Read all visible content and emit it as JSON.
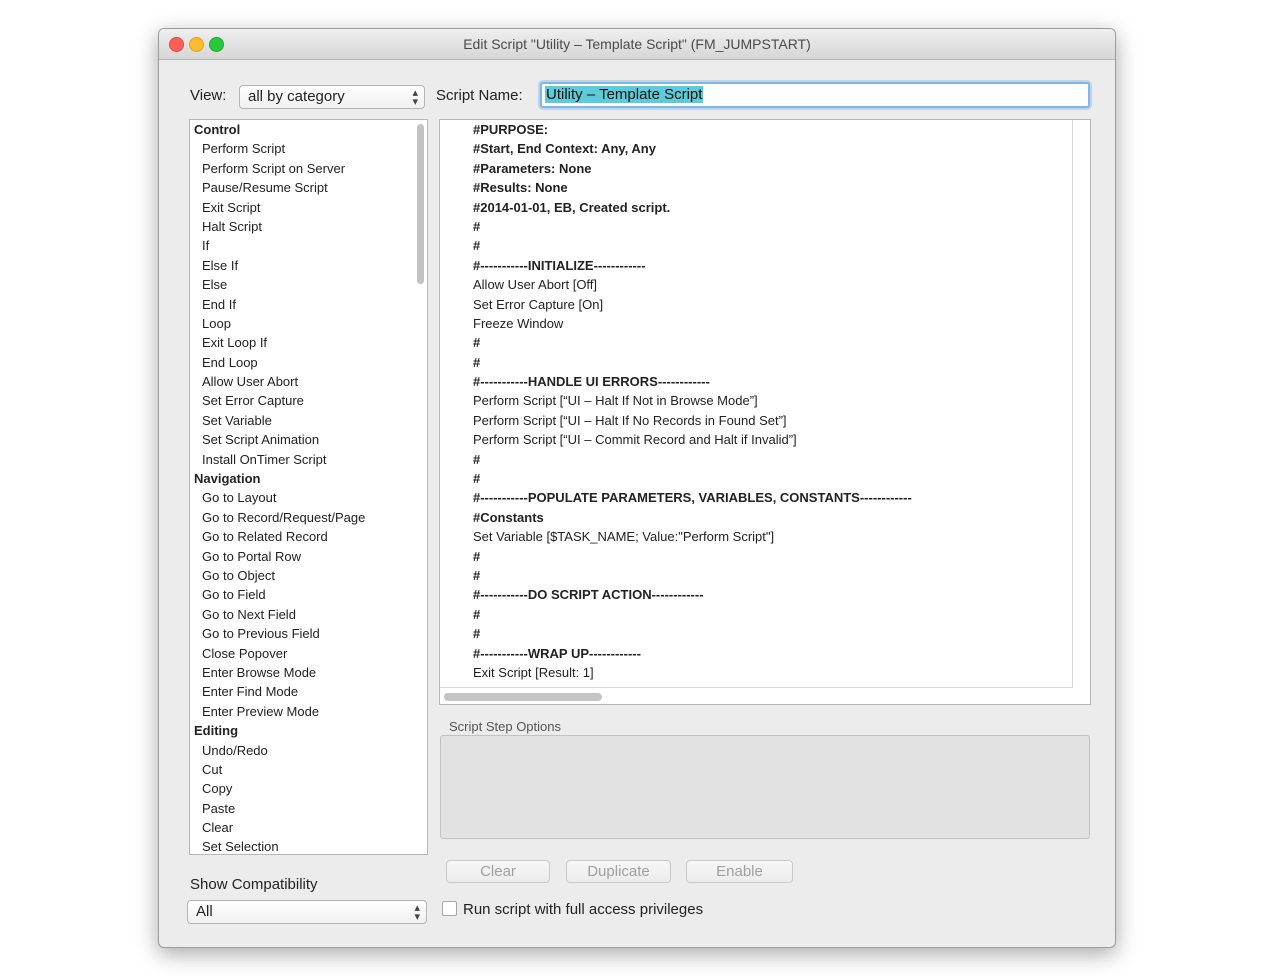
{
  "window": {
    "title": "Edit Script \"Utility – Template Script\" (FM_JUMPSTART)"
  },
  "toolbar": {
    "view_label": "View:",
    "view_value": "all by category",
    "script_name_label": "Script Name:",
    "script_name_value": "Utility – Template Script"
  },
  "steps": [
    {
      "type": "cat",
      "label": "Control"
    },
    {
      "type": "item",
      "label": "Perform Script"
    },
    {
      "type": "item",
      "label": "Perform Script on Server"
    },
    {
      "type": "item",
      "label": "Pause/Resume Script"
    },
    {
      "type": "item",
      "label": "Exit Script"
    },
    {
      "type": "item",
      "label": "Halt Script"
    },
    {
      "type": "item",
      "label": "If"
    },
    {
      "type": "item",
      "label": "Else If"
    },
    {
      "type": "item",
      "label": "Else"
    },
    {
      "type": "item",
      "label": "End If"
    },
    {
      "type": "item",
      "label": "Loop"
    },
    {
      "type": "item",
      "label": "Exit Loop If"
    },
    {
      "type": "item",
      "label": "End Loop"
    },
    {
      "type": "item",
      "label": "Allow User Abort"
    },
    {
      "type": "item",
      "label": "Set Error Capture"
    },
    {
      "type": "item",
      "label": "Set Variable"
    },
    {
      "type": "item",
      "label": "Set Script Animation"
    },
    {
      "type": "item",
      "label": "Install OnTimer Script"
    },
    {
      "type": "cat",
      "label": "Navigation"
    },
    {
      "type": "item",
      "label": "Go to Layout"
    },
    {
      "type": "item",
      "label": "Go to Record/Request/Page"
    },
    {
      "type": "item",
      "label": "Go to Related Record"
    },
    {
      "type": "item",
      "label": "Go to Portal Row"
    },
    {
      "type": "item",
      "label": "Go to Object"
    },
    {
      "type": "item",
      "label": "Go to Field"
    },
    {
      "type": "item",
      "label": "Go to Next Field"
    },
    {
      "type": "item",
      "label": "Go to Previous Field"
    },
    {
      "type": "item",
      "label": "Close Popover"
    },
    {
      "type": "item",
      "label": "Enter Browse Mode"
    },
    {
      "type": "item",
      "label": "Enter Find Mode"
    },
    {
      "type": "item",
      "label": "Enter Preview Mode"
    },
    {
      "type": "cat",
      "label": "Editing"
    },
    {
      "type": "item",
      "label": "Undo/Redo"
    },
    {
      "type": "item",
      "label": "Cut"
    },
    {
      "type": "item",
      "label": "Copy"
    },
    {
      "type": "item",
      "label": "Paste"
    },
    {
      "type": "item",
      "label": "Clear"
    },
    {
      "type": "item",
      "label": "Set Selection"
    }
  ],
  "script_lines": [
    {
      "text": "#PURPOSE:",
      "bold": true
    },
    {
      "text": "#Start, End Context: Any, Any",
      "bold": true
    },
    {
      "text": "#Parameters: None",
      "bold": true
    },
    {
      "text": "#Results: None",
      "bold": true
    },
    {
      "text": "#2014-01-01, EB, Created script.",
      "bold": true
    },
    {
      "text": "#",
      "bold": true
    },
    {
      "text": "#",
      "bold": true
    },
    {
      "text": "#-----------INITIALIZE------------",
      "bold": true
    },
    {
      "text": "Allow User Abort [Off]",
      "bold": false
    },
    {
      "text": "Set Error Capture [On]",
      "bold": false
    },
    {
      "text": "Freeze Window",
      "bold": false
    },
    {
      "text": "#",
      "bold": true
    },
    {
      "text": "#",
      "bold": true
    },
    {
      "text": "#-----------HANDLE UI ERRORS------------",
      "bold": true
    },
    {
      "text": "Perform Script [“UI – Halt If Not in Browse Mode”]",
      "bold": false
    },
    {
      "text": "Perform Script [“UI – Halt If No Records in Found Set”]",
      "bold": false
    },
    {
      "text": "Perform Script [“UI – Commit Record and Halt if Invalid”]",
      "bold": false
    },
    {
      "text": "#",
      "bold": true
    },
    {
      "text": "#",
      "bold": true
    },
    {
      "text": "#-----------POPULATE PARAMETERS, VARIABLES, CONSTANTS------------",
      "bold": true
    },
    {
      "text": "#Constants",
      "bold": true
    },
    {
      "text": "Set Variable [$TASK_NAME; Value:\"Perform Script\"]",
      "bold": false
    },
    {
      "text": "#",
      "bold": true
    },
    {
      "text": "#",
      "bold": true
    },
    {
      "text": "#-----------DO SCRIPT ACTION------------",
      "bold": true
    },
    {
      "text": "#",
      "bold": true
    },
    {
      "text": "#",
      "bold": true
    },
    {
      "text": "#-----------WRAP UP------------",
      "bold": true
    },
    {
      "text": "Exit Script [Result: 1]",
      "bold": false
    }
  ],
  "options": {
    "label": "Script Step Options"
  },
  "buttons": {
    "clear": "Clear",
    "duplicate": "Duplicate",
    "enable": "Enable"
  },
  "compat": {
    "label": "Show Compatibility",
    "value": "All"
  },
  "privileges": {
    "label": "Run script with full access privileges",
    "checked": false
  }
}
